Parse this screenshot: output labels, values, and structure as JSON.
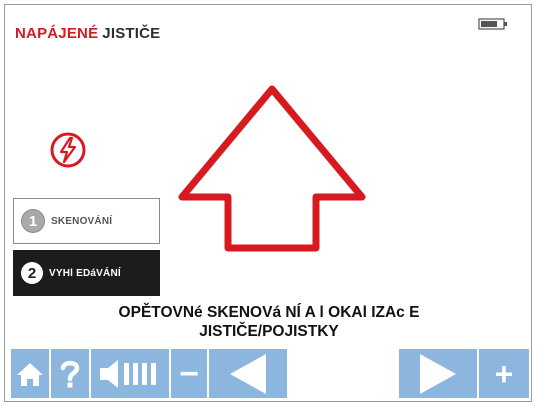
{
  "header": {
    "title_highlight": "NAPÁJENÉ",
    "title_rest": "JISTIČE"
  },
  "icons": {
    "power": "lightning-bolt-icon",
    "battery": "battery-icon",
    "arrow": "up-arrow-icon"
  },
  "mode_buttons": [
    {
      "number": "1",
      "label": "SKENOVÁNÍ",
      "active": false
    },
    {
      "number": "2",
      "label": "VYHl EDáVÁNÍ",
      "active": true
    }
  ],
  "message": {
    "line1": "OPĚTOVNé SKENOVá NÍ A l OKAl IZAc E",
    "line2": "JISTIČE/POJISTKY"
  },
  "toolbar": {
    "minus_label": "−",
    "plus_label": "+"
  },
  "colors": {
    "accent_red": "#d71920",
    "toolbar_blue": "#8db6de",
    "active_button_bg": "#1c1c1c"
  }
}
